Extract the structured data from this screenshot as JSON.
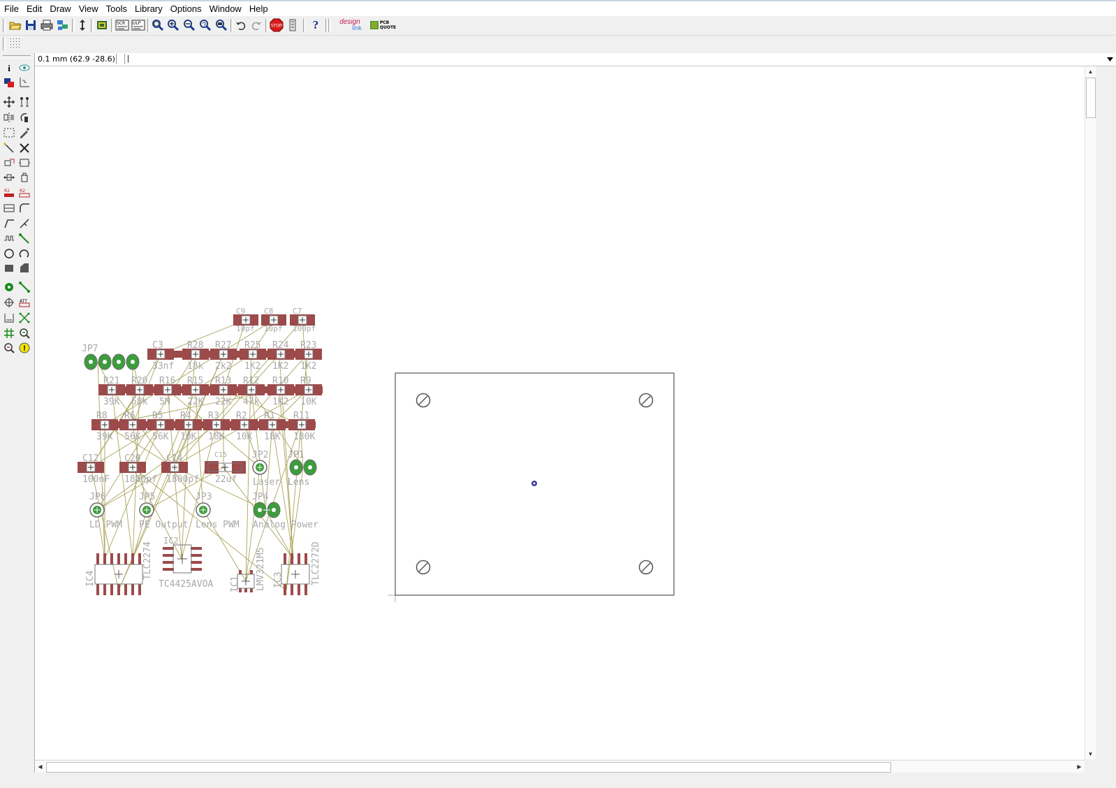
{
  "menu": [
    "File",
    "Edit",
    "Draw",
    "View",
    "Tools",
    "Library",
    "Options",
    "Window",
    "Help"
  ],
  "toolbar": {
    "icons": [
      "open-icon",
      "save-icon",
      "print-icon",
      "cam-icon",
      "zoom-fit-sheet-icon",
      "layer-icon",
      "script-icon",
      "ulp-icon",
      "zoom-fit-icon",
      "zoom-in-icon",
      "zoom-out-icon",
      "zoom-redraw-icon",
      "zoom-select-icon",
      "undo-icon",
      "redo-icon",
      "stop-icon",
      "go-icon",
      "help-icon",
      "designlink-icon",
      "pcb-quote-icon"
    ],
    "stop_label": "STOP",
    "help_label": "?",
    "designlink_label_1": "design",
    "designlink_label_2": "link",
    "pcbquote_label_1": "PCB",
    "pcbquote_label_2": "QUOTE"
  },
  "status": {
    "coord_readout": "0.1 mm (62.9 -28.6)",
    "command_text": "|"
  },
  "left_tools": [
    "info-icon",
    "show-icon",
    "display-icon",
    "mark-icon",
    "move-icon",
    "copy-icon",
    "mirror-icon",
    "rotate-icon",
    "group-icon",
    "change-icon",
    "paste-icon",
    "delete-icon",
    "add-icon",
    "name-icon",
    "value-icon",
    "smash-icon",
    "lock-icon",
    "miter-icon",
    "split-icon",
    "optimize-icon",
    "route-icon",
    "ripup-icon",
    "wire-icon",
    "text-icon",
    "circle-icon",
    "arc-icon",
    "rect-icon",
    "polygon-icon",
    "via-icon",
    "signal-icon",
    "hole-icon",
    "attribute-icon",
    "dimension-icon",
    "ratsnest-icon",
    "auto-icon",
    "errors-icon",
    "drc-icon",
    "erc-icon"
  ],
  "board": {
    "parts": {
      "jp7": "JP7",
      "c3": "C3",
      "c3_value": "33nf",
      "c9": "C9",
      "c9_value": "10pf",
      "c8": "C8",
      "c8_value": "10pf",
      "c7": "C7",
      "c7_value": "100pf",
      "r28": "R28",
      "r28_value": "18k",
      "r27": "R27",
      "r27_value": "2k2",
      "r25": "R25",
      "r25_value": "1K2",
      "r24": "R24",
      "r24_value": "1K2",
      "r23": "R23",
      "r23_value": "1K2",
      "r21": "R21",
      "r21_value": "39K",
      "r20": "R20",
      "r20_value": "68k",
      "r16": "R16",
      "r16_value": "5M",
      "r15": "R15",
      "r15_value": "22K",
      "r13": "R13",
      "r13_value": "22K",
      "r12": "R12",
      "r12_value": "47k",
      "r10": "R10",
      "r10_value": "1K2",
      "r9": "R9",
      "r9_value": "10K",
      "r8": "R8",
      "r8_value": "39K",
      "r6": "R6",
      "r6_value": "56K",
      "r5": "R5",
      "r5_value": "56K",
      "r4": "R4",
      "r4_value": "10K",
      "r3": "R3",
      "r3_value": "18K",
      "r2": "R2",
      "r2_value": "10K",
      "r1": "R1",
      "r1_value": "18K",
      "r11": "R11",
      "r11_value": "180K",
      "c12": "C12",
      "c12_value": "100nF",
      "c20": "C20",
      "c20_value": "1800pf",
      "c14": "C14",
      "c14_value": "1800pf",
      "c15": "C15",
      "c15_value": "22uf",
      "jp2": "JP2",
      "jp2_value": "Laser",
      "jp1": "JP1",
      "jp1_value": "Lens",
      "jp6": "JP6",
      "jp6_value": "LD PWM",
      "jp5": "JP5",
      "jp5_value": "PE Output",
      "jp3": "JP3",
      "jp3_value": "Lens PWM",
      "jp4": "JP4",
      "jp4_value": "Analog Power",
      "ic2": "IC2",
      "ic2_value": "TC4425AVOA",
      "ic4": "IC4",
      "ic4_value": "TLC2274",
      "ic1": "IC1",
      "ic1_value": "LMV321M5",
      "ic3": "IC3",
      "ic3_value": "TLC2272D"
    }
  }
}
